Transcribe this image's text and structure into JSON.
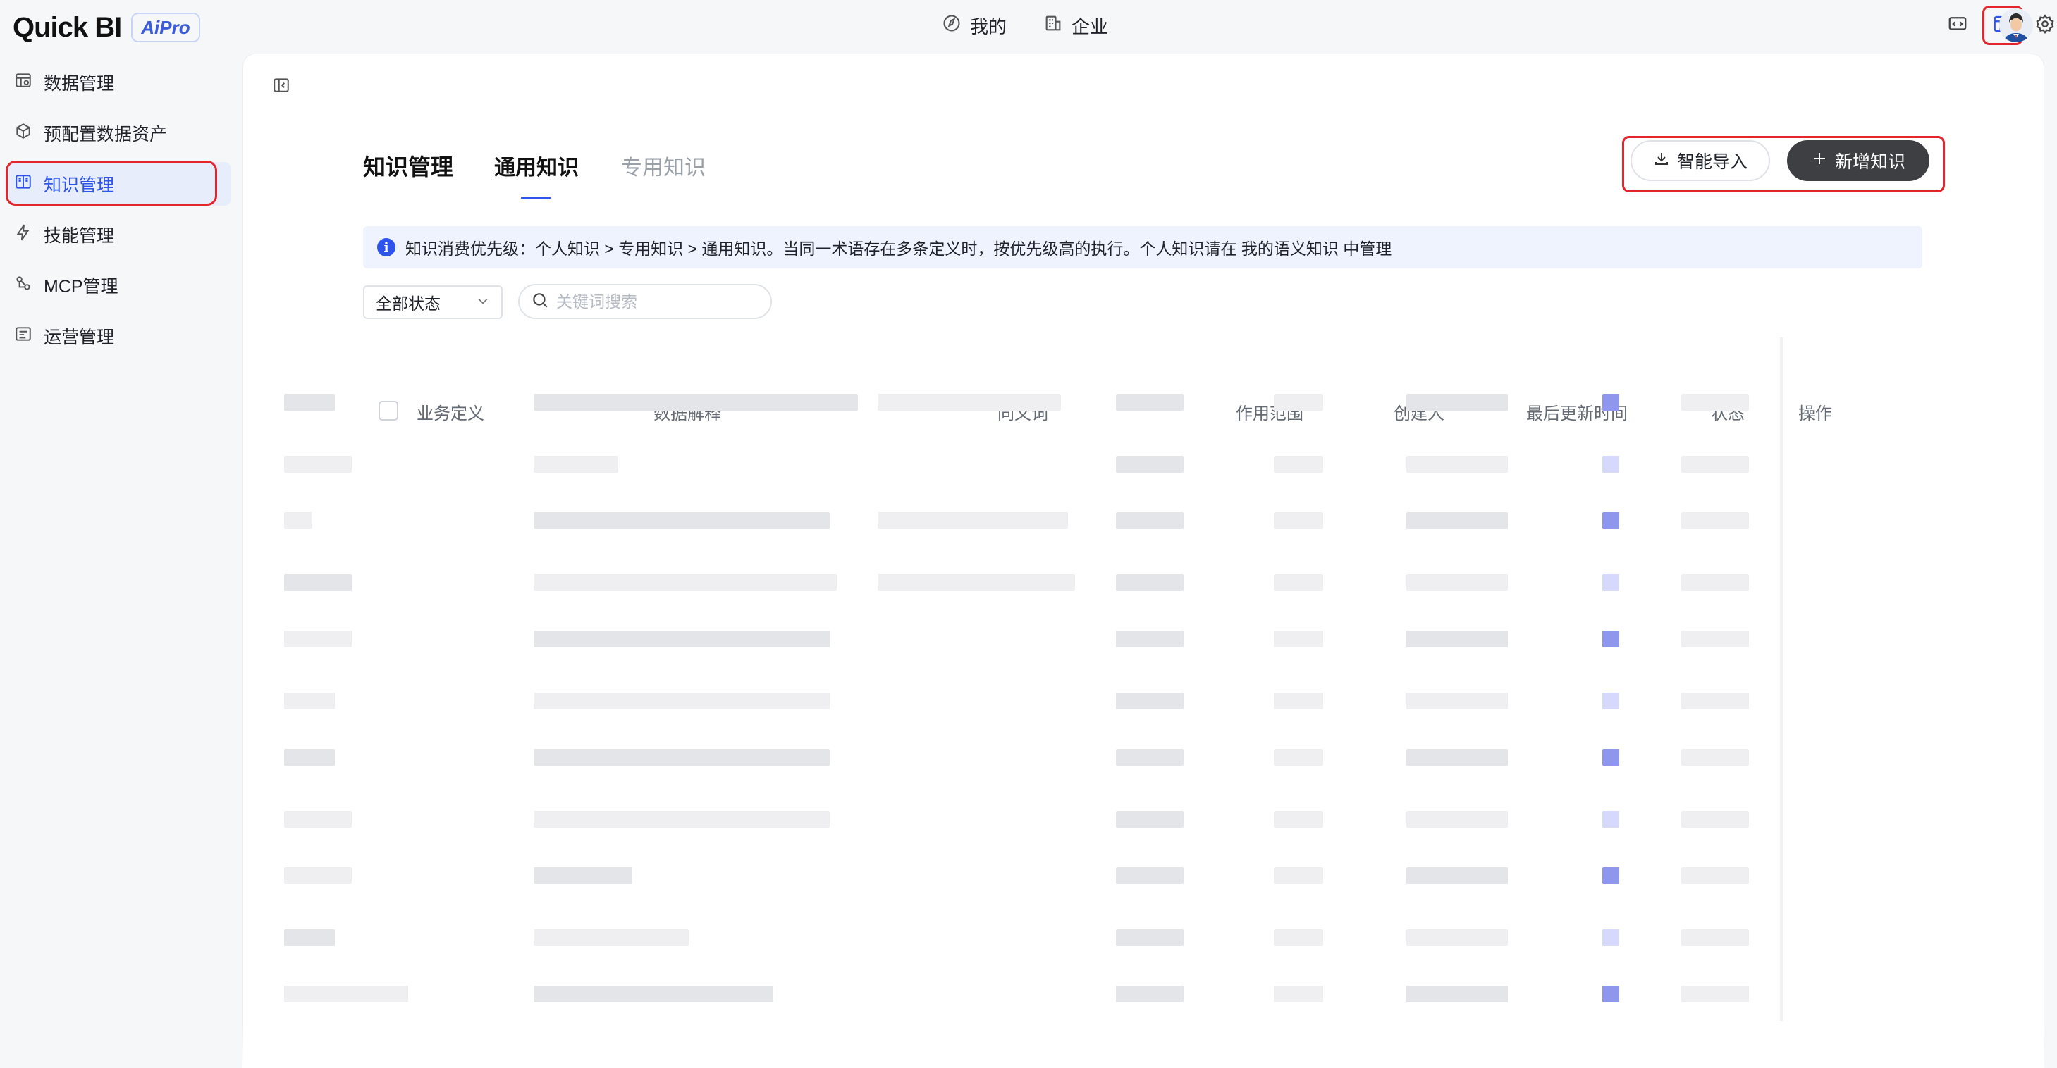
{
  "app": {
    "logo_text": "Quick BI",
    "logo_badge": "AiPro"
  },
  "top_nav": {
    "items": [
      {
        "label": "我的",
        "icon": "compass-icon"
      },
      {
        "label": "企业",
        "icon": "building-icon"
      }
    ],
    "right_icons": [
      "code-screen-icon",
      "dashboard-table-icon",
      "gear-icon",
      "user-avatar"
    ]
  },
  "sidebar": {
    "items": [
      {
        "label": "数据管理",
        "icon": "data-table-icon"
      },
      {
        "label": "预配置数据资产",
        "icon": "cube-icon"
      },
      {
        "label": "知识管理",
        "icon": "book-icon",
        "active": true
      },
      {
        "label": "技能管理",
        "icon": "bolt-icon"
      },
      {
        "label": "MCP管理",
        "icon": "mcp-link-icon"
      },
      {
        "label": "运营管理",
        "icon": "operations-icon"
      }
    ]
  },
  "page": {
    "title": "知识管理",
    "tabs": [
      {
        "label": "通用知识",
        "active": true
      },
      {
        "label": "专用知识",
        "active": false
      }
    ],
    "import_button": "智能导入",
    "add_button": "新增知识",
    "info_text": "知识消费优先级：个人知识 > 专用知识 > 通用知识。当同一术语存在多条定义时，按优先级高的执行。个人知识请在 我的语义知识 中管理",
    "filter": {
      "selected": "全部状态"
    },
    "search": {
      "placeholder": "关键词搜索",
      "value": ""
    }
  },
  "table": {
    "columns": [
      "业务定义",
      "数据解释",
      "同义词",
      "作用范围",
      "创建人",
      "最后更新时间",
      "状态",
      "操作"
    ],
    "row_count": 11
  },
  "colors": {
    "accent": "#2f54eb",
    "highlight_ring": "#e3262c",
    "primary_button": "#3d3f43",
    "info_bg": "#eef3fd",
    "status_on": "#8f96ee"
  }
}
